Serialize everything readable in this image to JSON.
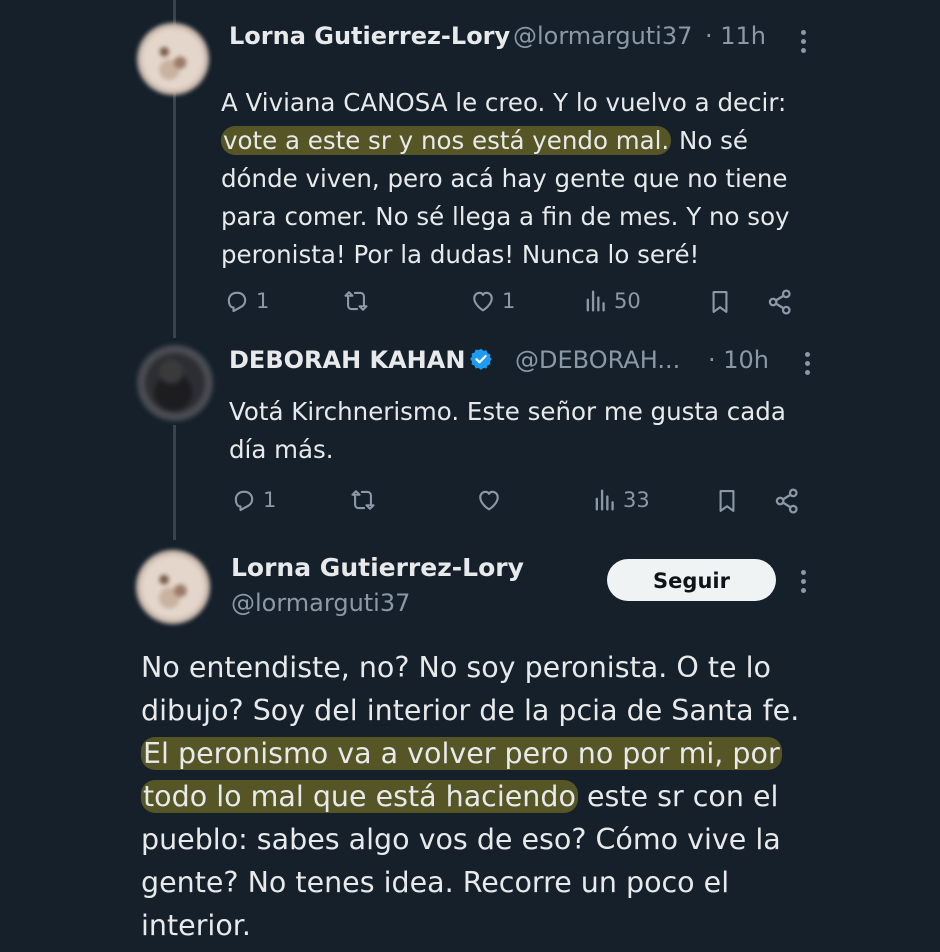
{
  "replies": [
    {
      "author_name": "Lorna Gutierrez-Lory",
      "author_handle": "@lormarguti37",
      "time": "· 11h",
      "text_before": "A Viviana CANOSA le creo. Y lo vuelvo a decir: ",
      "text_highlight": "vote a este sr y nos está yendo mal.",
      "text_after": " No sé dónde viven, pero acá hay gente que no tiene para comer. No sé llega a fin de mes. Y no soy peronista! Por la dudas! Nunca lo seré!",
      "stats": {
        "replies": "1",
        "reposts": "",
        "likes": "1",
        "views": "50"
      }
    },
    {
      "author_name": "DEBORAH KAHAN",
      "verified": true,
      "author_handle": "@DEBORAH...",
      "time": "· 10h",
      "text": "Votá Kirchnerismo. Este señor me gusta cada día más.",
      "stats": {
        "replies": "1",
        "reposts": "",
        "likes": "",
        "views": "33"
      }
    }
  ],
  "main_tweet": {
    "author_name": "Lorna Gutierrez-Lory",
    "author_handle": "@lormarguti37",
    "follow_label": "Seguir",
    "text_before": "No entendiste, no? No soy peronista. O te lo dibujo? Soy del interior de la pcia de Santa fe. ",
    "text_highlight": "El peronismo va a volver pero no por mi, por todo lo mal que está haciendo",
    "text_after": " este sr con el pueblo: sabes algo vos de eso? Cómo vive la gente? No tenes idea. Recorre un poco el interior."
  },
  "colors": {
    "background": "#15202b",
    "text": "#e7e9ea",
    "secondary": "#8b98a5",
    "verified": "#1d9bf0",
    "highlight": "#686424"
  },
  "icons": [
    "reply-icon",
    "repost-icon",
    "like-icon",
    "views-icon",
    "bookmark-icon",
    "share-icon",
    "more-icon",
    "verified-icon"
  ]
}
